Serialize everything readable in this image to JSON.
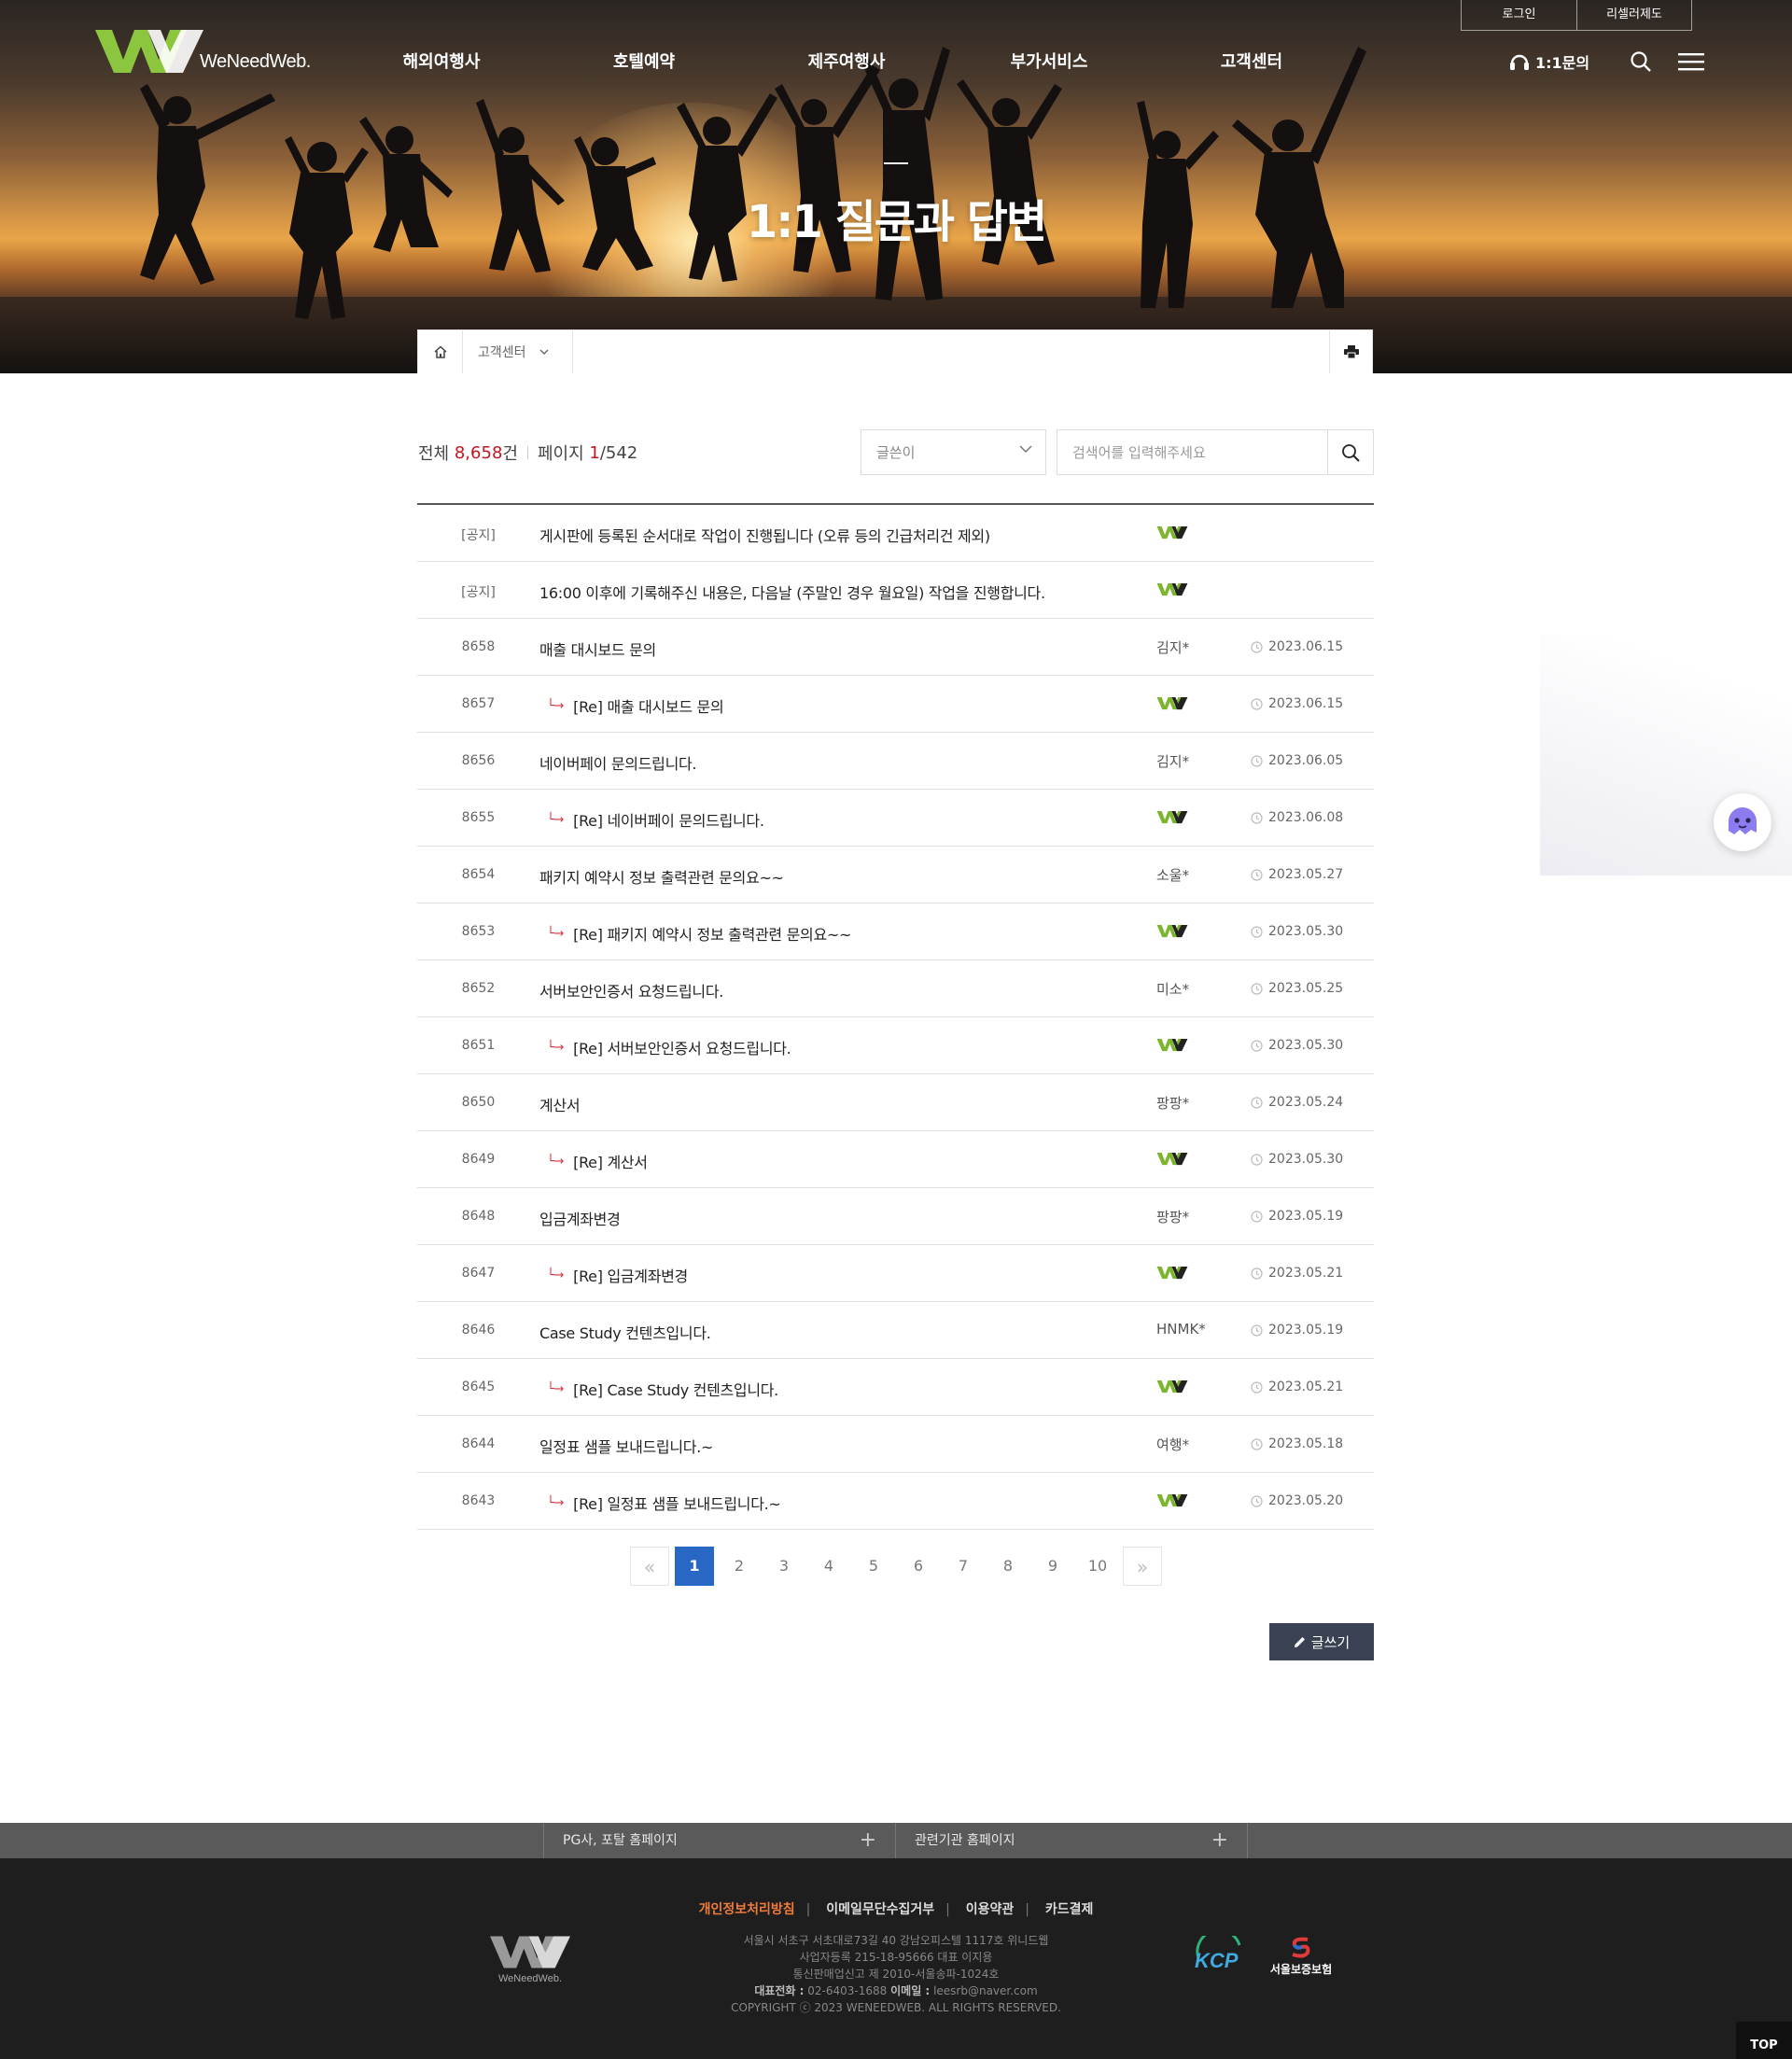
{
  "brand": {
    "name": "WeNeedWeb."
  },
  "util": {
    "login": "로그인",
    "reseller": "리셀러제도"
  },
  "gnb": [
    "해외여행사",
    "호텔예약",
    "제주여행사",
    "부가서비스",
    "고객센터"
  ],
  "qa_link": "1:1문의",
  "hero": {
    "title": "1:1 질문과 답변"
  },
  "location": {
    "depth1": "고객센터"
  },
  "summary": {
    "total_label": "전체",
    "total": "8,658",
    "total_unit": "건",
    "page_label": "페이지",
    "page_current": "1",
    "page_total": "/542"
  },
  "search": {
    "field": "글쓴이",
    "placeholder": "검색어를 입력해주세요"
  },
  "notice_label": "[공지]",
  "re_mark": "└→",
  "posts": [
    {
      "num": "[공지]",
      "subject": "게시판에 등록된 순서대로 작업이 진행됩니다 (오류 등의 긴급처리건 제외)",
      "writer": "",
      "date": "",
      "reply": false,
      "admin": true
    },
    {
      "num": "[공지]",
      "subject": "16:00 이후에 기록해주신 내용은, 다음날 (주말인 경우 월요일) 작업을 진행합니다.",
      "writer": "",
      "date": "",
      "reply": false,
      "admin": true
    },
    {
      "num": "8658",
      "subject": "매출 대시보드 문의",
      "writer": "김지*",
      "date": "2023.06.15",
      "reply": false,
      "admin": false
    },
    {
      "num": "8657",
      "subject": "[Re] 매출 대시보드 문의",
      "writer": "",
      "date": "2023.06.15",
      "reply": true,
      "admin": true
    },
    {
      "num": "8656",
      "subject": "네이버페이 문의드립니다.",
      "writer": "김지*",
      "date": "2023.06.05",
      "reply": false,
      "admin": false
    },
    {
      "num": "8655",
      "subject": "[Re] 네이버페이 문의드립니다.",
      "writer": "",
      "date": "2023.06.08",
      "reply": true,
      "admin": true
    },
    {
      "num": "8654",
      "subject": "패키지 예약시 정보 출력관련 문의요~~",
      "writer": "소울*",
      "date": "2023.05.27",
      "reply": false,
      "admin": false
    },
    {
      "num": "8653",
      "subject": "[Re] 패키지 예약시 정보 출력관련 문의요~~",
      "writer": "",
      "date": "2023.05.30",
      "reply": true,
      "admin": true
    },
    {
      "num": "8652",
      "subject": "서버보안인증서 요청드립니다.",
      "writer": "미소*",
      "date": "2023.05.25",
      "reply": false,
      "admin": false
    },
    {
      "num": "8651",
      "subject": "[Re] 서버보안인증서 요청드립니다.",
      "writer": "",
      "date": "2023.05.30",
      "reply": true,
      "admin": true
    },
    {
      "num": "8650",
      "subject": "계산서",
      "writer": "팡팡*",
      "date": "2023.05.24",
      "reply": false,
      "admin": false
    },
    {
      "num": "8649",
      "subject": "[Re] 계산서",
      "writer": "",
      "date": "2023.05.30",
      "reply": true,
      "admin": true
    },
    {
      "num": "8648",
      "subject": "입금계좌변경",
      "writer": "팡팡*",
      "date": "2023.05.19",
      "reply": false,
      "admin": false
    },
    {
      "num": "8647",
      "subject": "[Re] 입금계좌변경",
      "writer": "",
      "date": "2023.05.21",
      "reply": true,
      "admin": true
    },
    {
      "num": "8646",
      "subject": "Case Study 컨텐츠입니다.",
      "writer": "HNMK*",
      "date": "2023.05.19",
      "reply": false,
      "admin": false
    },
    {
      "num": "8645",
      "subject": "[Re] Case Study 컨텐츠입니다.",
      "writer": "",
      "date": "2023.05.21",
      "reply": true,
      "admin": true
    },
    {
      "num": "8644",
      "subject": "일정표 샘플 보내드립니다.~",
      "writer": "여행*",
      "date": "2023.05.18",
      "reply": false,
      "admin": false
    },
    {
      "num": "8643",
      "subject": "[Re] 일정표 샘플 보내드립니다.~",
      "writer": "",
      "date": "2023.05.20",
      "reply": true,
      "admin": true
    }
  ],
  "pagination": {
    "prev": "«",
    "next": "»",
    "pages": [
      "1",
      "2",
      "3",
      "4",
      "5",
      "6",
      "7",
      "8",
      "9",
      "10"
    ],
    "current": "1"
  },
  "write_button": "글쓰기",
  "footer_bar": {
    "left": "PG사, 포탈 홈페이지",
    "right": "관련기관 홈페이지"
  },
  "footer_links": [
    "개인정보처리방침",
    "이메일무단수집거부",
    "이용약관",
    "카드결제"
  ],
  "footer_info": {
    "line1": "서울시 서초구 서초대로73길 40 강남오피스텔 1117호 위니드웹",
    "line2": "사업자등록 215-18-95666 대표 이지용",
    "line3": "통신판매업신고 제 2010-서울송파-1024호",
    "tel_label": "대표전화 :",
    "tel": "02-6403-1688",
    "email_label": "이메일 :",
    "email": "leesrb@naver.com",
    "copyright": "COPYRIGHT ⓒ 2023 WENEEDWEB. ALL RIGHTS RESERVED."
  },
  "partners": {
    "kcp": "KCP",
    "sgi": "서울보증보험"
  },
  "top_button": "TOP",
  "colors": {
    "accent_blue": "#2867c3",
    "accent_red": "#c4141d",
    "write_btn": "#3a4152",
    "footer_highlight": "#f07b3b",
    "logo_green": "#8cc63f"
  }
}
